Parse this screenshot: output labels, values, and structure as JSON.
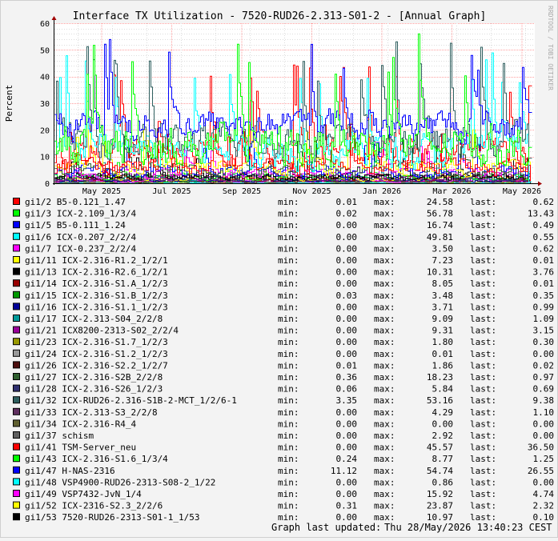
{
  "watermark": "RRDTOOL / TOBI OETIKER",
  "footer": {
    "label": "Graph last updated:",
    "timestamp": "Thu 28/May/2026 13:40:23 CEST"
  },
  "legend_labels": {
    "min": "min:",
    "max": "max:",
    "last": "last:"
  },
  "chart_data": {
    "type": "line",
    "title": "Interface TX Utilization - 7520-RUD26-2.313-S01-2 - [Annual Graph]",
    "xlabel": "",
    "ylabel": "Percent",
    "ylim": [
      0,
      60
    ],
    "yticks": [
      0,
      10,
      20,
      30,
      40,
      50,
      60
    ],
    "xticks": [
      "May 2025",
      "Jul 2025",
      "Sep 2025",
      "Nov 2025",
      "Jan 2026",
      "Mar 2026",
      "May 2026"
    ],
    "grid": true,
    "legend_position": "bottom",
    "series": [
      {
        "name": "gi1/2 B5-0.121_1.47",
        "color": "#ff0000",
        "min": "0.01",
        "max": "24.58",
        "last": "0.62"
      },
      {
        "name": "gi1/3 ICX-2.109_1/3/4",
        "color": "#00ff00",
        "min": "0.02",
        "max": "56.78",
        "last": "13.43"
      },
      {
        "name": "gi1/5 B5-0.111_1.24",
        "color": "#0000ff",
        "min": "0.00",
        "max": "16.74",
        "last": "0.49"
      },
      {
        "name": "gi1/6 ICX-0.207_2/2/4",
        "color": "#00ffff",
        "min": "0.00",
        "max": "49.81",
        "last": "0.55"
      },
      {
        "name": "gi1/7 ICX-0.237_2/2/4",
        "color": "#ff00ff",
        "min": "0.00",
        "max": "3.50",
        "last": "0.62"
      },
      {
        "name": "gi1/11 ICX-2.316-R1.2_1/2/1",
        "color": "#ffff00",
        "min": "0.00",
        "max": "7.23",
        "last": "0.01"
      },
      {
        "name": "gi1/13 ICX-2.316-R2.6_1/2/1",
        "color": "#000000",
        "min": "0.00",
        "max": "10.31",
        "last": "3.76"
      },
      {
        "name": "gi1/14 ICX-2.316-S1.A_1/2/3",
        "color": "#990000",
        "min": "0.00",
        "max": "8.05",
        "last": "0.01"
      },
      {
        "name": "gi1/15 ICX-2.316-S1.B_1/2/3",
        "color": "#009900",
        "min": "0.03",
        "max": "3.48",
        "last": "0.35"
      },
      {
        "name": "gi1/16 ICX-2.316-S1.1_1/2/3",
        "color": "#000099",
        "min": "0.00",
        "max": "3.71",
        "last": "0.99"
      },
      {
        "name": "gi1/17 ICX-2.313-S04_2/2/8",
        "color": "#009999",
        "min": "0.00",
        "max": "9.09",
        "last": "1.09"
      },
      {
        "name": "gi1/21 ICX8200-2313-S02_2/2/4",
        "color": "#990099",
        "min": "0.00",
        "max": "9.31",
        "last": "3.15"
      },
      {
        "name": "gi1/23 ICX-2.316-S1.7_1/2/3",
        "color": "#999900",
        "min": "0.00",
        "max": "1.80",
        "last": "0.30"
      },
      {
        "name": "gi1/24 ICX-2.316-S1.2_1/2/3",
        "color": "#999999",
        "min": "0.00",
        "max": "0.01",
        "last": "0.00"
      },
      {
        "name": "gi1/26 ICX-2.316-S2.2_1/2/7",
        "color": "#4d0f0f",
        "min": "0.01",
        "max": "1.86",
        "last": "0.02"
      },
      {
        "name": "gi1/27 ICX-2.316-S2B_2/2/8",
        "color": "#2f5f2f",
        "min": "0.36",
        "max": "18.23",
        "last": "0.97"
      },
      {
        "name": "gi1/28 ICX-2.316-S26_1/2/3",
        "color": "#2f2f6f",
        "min": "0.06",
        "max": "5.84",
        "last": "0.69"
      },
      {
        "name": "gi1/32 ICX-RUD26-2.316-S1B-2-MCT_1/2/6-1",
        "color": "#2f5f5f",
        "min": "3.35",
        "max": "53.16",
        "last": "9.38"
      },
      {
        "name": "gi1/33 ICX-2.313-S3_2/2/8",
        "color": "#5f2f5f",
        "min": "0.00",
        "max": "4.29",
        "last": "1.10"
      },
      {
        "name": "gi1/34 ICX-2.316-R4_4",
        "color": "#5f5f2f",
        "min": "0.00",
        "max": "0.00",
        "last": "0.00"
      },
      {
        "name": "gi1/37 schism",
        "color": "#5f5f5f",
        "min": "0.00",
        "max": "2.92",
        "last": "0.00"
      },
      {
        "name": "gi1/41 TSM-Server_neu",
        "color": "#ff0000",
        "min": "0.00",
        "max": "45.57",
        "last": "36.50"
      },
      {
        "name": "gi1/43 ICX-2.316-S1.6_1/3/4",
        "color": "#00ff00",
        "min": "0.24",
        "max": "8.77",
        "last": "1.25"
      },
      {
        "name": "gi1/47 H-NAS-2316",
        "color": "#0000ff",
        "min": "11.12",
        "max": "54.74",
        "last": "26.55"
      },
      {
        "name": "gi1/48 VSP4900-RUD26-2313-S08-2_1/22",
        "color": "#00ffff",
        "min": "0.00",
        "max": "0.86",
        "last": "0.00"
      },
      {
        "name": "gi1/49 VSP7432-JvN_1/4",
        "color": "#ff00ff",
        "min": "0.00",
        "max": "15.92",
        "last": "4.74"
      },
      {
        "name": "gi1/52 ICX-2316-S2.3_2/2/6",
        "color": "#ffff00",
        "min": "0.31",
        "max": "23.87",
        "last": "2.32"
      },
      {
        "name": "gi1/53 7520-RUD26-2313-S01-1_1/53",
        "color": "#000000",
        "min": "0.00",
        "max": "10.97",
        "last": "0.10"
      }
    ]
  }
}
